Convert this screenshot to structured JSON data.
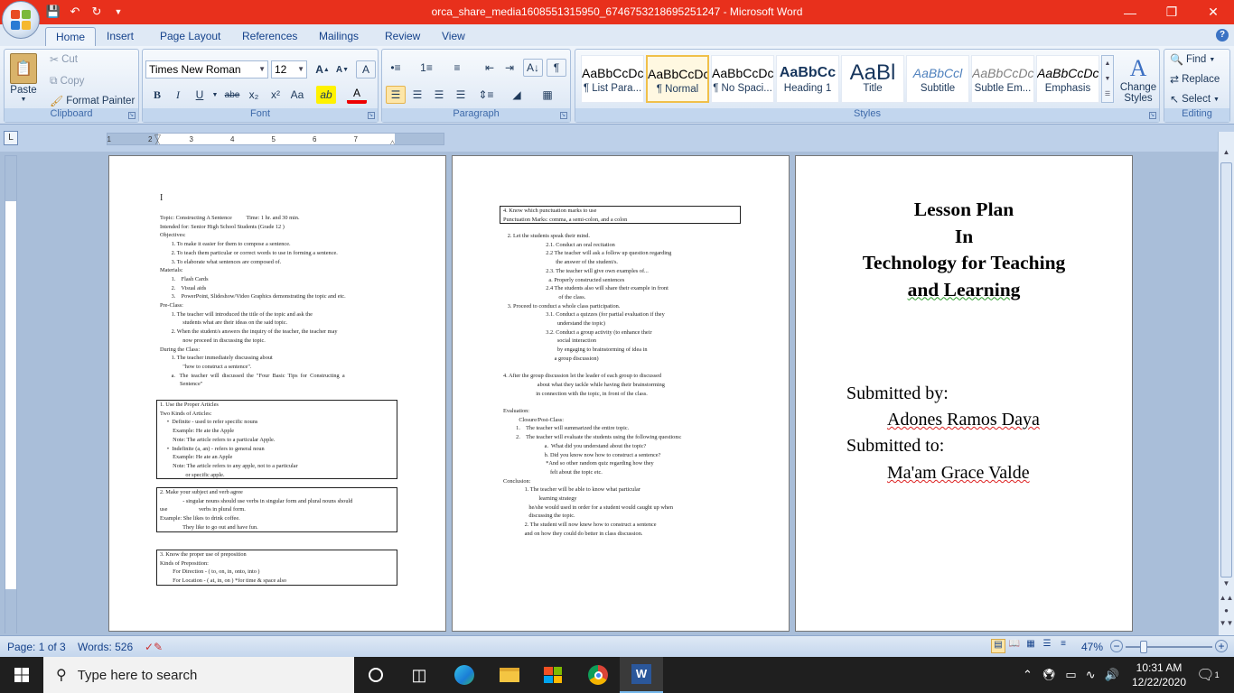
{
  "window": {
    "title": "orca_share_media1608551315950_6746753218695251247 - Microsoft Word",
    "minimize": "—",
    "restore": "❐",
    "close": "✕"
  },
  "tabs": [
    "Home",
    "Insert",
    "Page Layout",
    "References",
    "Mailings",
    "Review",
    "View"
  ],
  "clipboard": {
    "paste": "Paste",
    "cut": "Cut",
    "copy": "Copy",
    "format_painter": "Format Painter",
    "label": "Clipboard"
  },
  "font": {
    "name": "Times New Roman",
    "size": "12",
    "label": "Font",
    "grow": "A",
    "shrink": "A",
    "clear": "A",
    "bold": "B",
    "italic": "I",
    "underline": "U",
    "strike": "abe",
    "sub": "x₂",
    "sup": "x²",
    "case": "Aa",
    "highlight": "ab",
    "color": "A"
  },
  "paragraph": {
    "label": "Paragraph",
    "pilcrow": "¶",
    "sort": "A↓"
  },
  "styles": {
    "label": "Styles",
    "items": [
      {
        "sample": "AaBbCcDc",
        "name": "¶ List Para...",
        "color": "#000000"
      },
      {
        "sample": "AaBbCcDc",
        "name": "¶ Normal",
        "color": "#000000"
      },
      {
        "sample": "AaBbCcDc",
        "name": "¶ No Spaci...",
        "color": "#000000"
      },
      {
        "sample": "AaBbCc",
        "name": "Heading 1",
        "color": "#17365d"
      },
      {
        "sample": "AaBl",
        "name": "Title",
        "color": "#17365d"
      },
      {
        "sample": "AaBbCcl",
        "name": "Subtitle",
        "color": "#4f81bd"
      },
      {
        "sample": "AaBbCcDc",
        "name": "Subtle Em...",
        "color": "#808080"
      },
      {
        "sample": "AaBbCcDc",
        "name": "Emphasis",
        "color": "#000000"
      }
    ],
    "change_styles": "Change Styles"
  },
  "editing": {
    "label": "Editing",
    "find": "Find",
    "replace": "Replace",
    "select": "Select"
  },
  "ruler": {
    "ticks": [
      "1",
      "2",
      "3",
      "4",
      "5",
      "6",
      "7"
    ]
  },
  "page1": {
    "cursor": "I",
    "lines": [
      "Topic: Constructing A Sentence          Time: 1 hr. and 30 min.",
      "Intended for: Senior High School Students (Grade 12 )",
      "Objectives:",
      "        1. To make it easier for them to compose a sentence.",
      "        2. To teach them particular or correct words to use in forming a sentence.",
      "        3. To elaborate what sentences are composed of.",
      "Materials:",
      "        1.    Flash Cards",
      "        2.    Visual aids",
      "        3.    PowerPoint, Slideshow/Video Graphics demonstrating the topic and etc.",
      "Pre-Class:",
      "        1. The teacher will introduced the title of the topic and ask the",
      "                students what are their ideas on the said topic.",
      "        2. When the student/s answers the inquiry of the teacher, the teacher may",
      "                now proceed in discussing the topic.",
      "During the Class:",
      "        1. The teacher immediately discussing about",
      "                \"how to construct a sentence\".",
      "        a.   The  teacher  will  discussed  the  \"Four  Basic  Tips  for  Constructing  a",
      "              Sentence\""
    ],
    "box1": [
      "1. Use the Proper Articles",
      "Two Kinds of Articles:",
      "     •  Definite - used to refer specific nouns",
      "         Example: He ate the Apple",
      "         Note: The article refers to a particular Apple.",
      "     •  Indefinite (a, an) - refers to general noun",
      "         Example: He ate an Apple",
      "         Note: The article refers to any apple, not to a particular",
      "                  or specific apple."
    ],
    "box2": [
      "2. Make your subject and verb agree",
      "                - singular nouns should use verbs in singular form and plural nouns should",
      "use                      verbs in plural form.",
      "Example: She likes to drink coffee.",
      "                They like to go out and have fun."
    ],
    "box3": [
      "3. Know the proper use of preposition",
      "Kinds of Preposition:",
      "         For Direction - ( to, on, in, onto, into )",
      "         For Location - ( at, in, on ) *for time & space also"
    ]
  },
  "page2": {
    "box4": [
      "4. Know which punctuation marks to use",
      "Punctuation Marks: comma, a semi-colon, and a colon"
    ],
    "lines": [
      "   2. Let the students speak their mind.",
      "                              2.1. Conduct an oral recitation",
      "                              2.2 The teacher will ask a follow up question regarding",
      "                                     the answer of the student/s.",
      "                              2.3. The teacher will give own examples of...",
      "                                a. Properly constructed sentences",
      "                              2.4 The students also will share their example in front",
      "                                       of the class.",
      "   3. Proceed to conduct a whole class participation.",
      "                              3.1. Conduct a quizzes (for partial evaluation if they",
      "                                      understand the topic)",
      "                              3.2. Conduct a group activity (to enhance their",
      "                                      social interaction",
      "                                      by engaging to brainstorming of idea in",
      "                                    a group discussion)",
      "",
      "4. After the group discussion let the leader of each group to discussed",
      "                        about what they tackle while having their brainstorming",
      "                       in connection with the topic, in front of the class.",
      "",
      "Evaluation:",
      "           Closure/Post-Class:",
      "         1.    The teacher will summarized the entire topic.",
      "         2.    The teacher will evaluate the students using the following questions:",
      "                             a.  What did you understand about the topic?",
      "                             b. Did you know now how to construct a sentence?",
      "                              *And so other random quiz regarding how they",
      "                                 felt about the topic etc.",
      "Conclusion:",
      "               1. The teacher will be able to know what particular",
      "                         learning strategy",
      "                  he/she would used in order for a student would caught up when",
      "                  discussing the topic.",
      "               2. The student will now knew how to construct a sentence",
      "               and on how they could do better in class discussion."
    ]
  },
  "page3": {
    "title_lines": [
      "Lesson Plan",
      "In",
      "Technology for Teaching",
      "and Learning"
    ],
    "submitted_by_label": "Submitted by:",
    "submitted_by": "Adones Ramos Daya",
    "submitted_to_label": "Submitted to:",
    "submitted_to": "Ma'am Grace Valde"
  },
  "status": {
    "page": "Page: 1 of 3",
    "words": "Words: 526",
    "zoom": "47%",
    "zoom_out": "−",
    "zoom_in": "+",
    "zoom_level": 0.47
  },
  "taskbar": {
    "search_placeholder": "Type here to search",
    "time": "10:31 AM",
    "date": "12/22/2020",
    "notifications": "1"
  },
  "colors": {
    "titlebar": "#e8301c",
    "ribbon": "#dfe9f5",
    "document_bg": "#a9bed9",
    "taskbar": "#1f1f1f"
  }
}
